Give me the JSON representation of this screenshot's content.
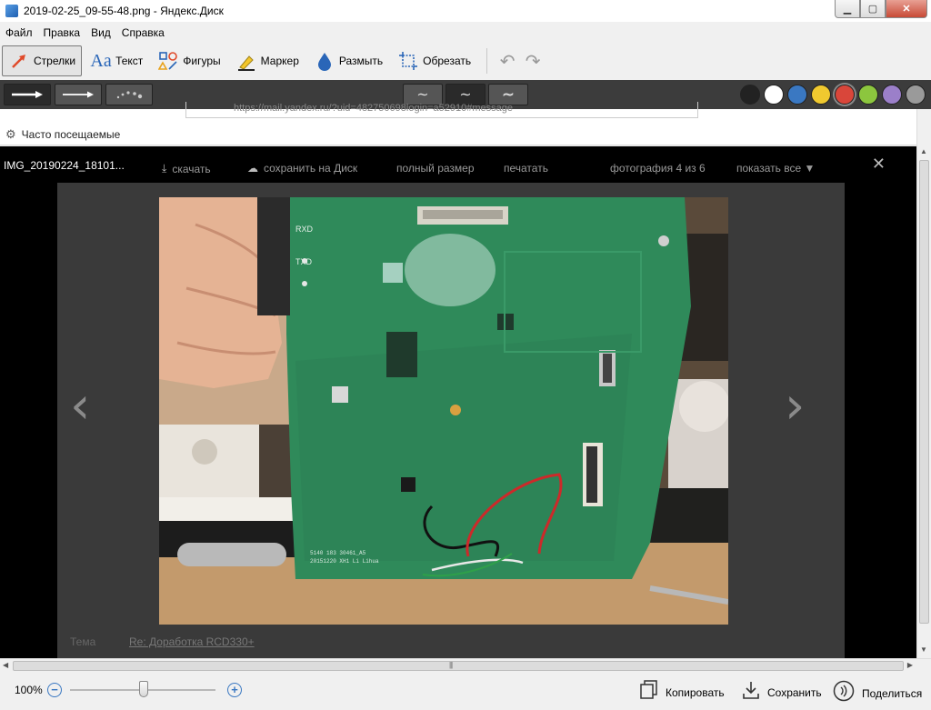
{
  "window": {
    "title": "2019-02-25_09-55-48.png - Яндекс.Диск",
    "min": "▁",
    "max": "▢",
    "close": "✕"
  },
  "menu": [
    "Файл",
    "Правка",
    "Вид",
    "Справка"
  ],
  "tools": [
    {
      "label": "Стрелки",
      "icon": "arrow-icon",
      "active": true
    },
    {
      "label": "Текст",
      "icon": "text-icon",
      "active": false
    },
    {
      "label": "Фигуры",
      "icon": "shapes-icon",
      "active": false
    },
    {
      "label": "Маркер",
      "icon": "marker-icon",
      "active": false
    },
    {
      "label": "Размыть",
      "icon": "blur-icon",
      "active": false
    },
    {
      "label": "Обрезать",
      "icon": "crop-icon",
      "active": false
    }
  ],
  "colors": [
    "#222222",
    "#ffffff",
    "#3a78c2",
    "#f0c92f",
    "#d9463a",
    "#8cc63e",
    "#9b7fc9",
    "#9a9a9a"
  ],
  "browser": {
    "address": "https://mail.yandex.ru/?uid=482750698login=a52910#message",
    "bookmark": "Часто посещаемые"
  },
  "viewer": {
    "filename": "IMG_20190224_18101...",
    "download": "скачать",
    "save_to_disk": "сохранить на Диск",
    "full_size": "полный размер",
    "print": "печатать",
    "counter": "фотография 4 из 6",
    "show_all": "показать все ▼",
    "theme_label": "Тема",
    "theme_link": "Re: Доработка RCD330+",
    "board_text_1": "RXD",
    "board_text_2": "TXD",
    "board_text_3": "5140 183 30461_A5",
    "board_text_4": "20151220  XH1  Li Lihua"
  },
  "status": {
    "zoom": "100%",
    "copy": "Копировать",
    "save": "Сохранить",
    "share": "Поделиться"
  }
}
